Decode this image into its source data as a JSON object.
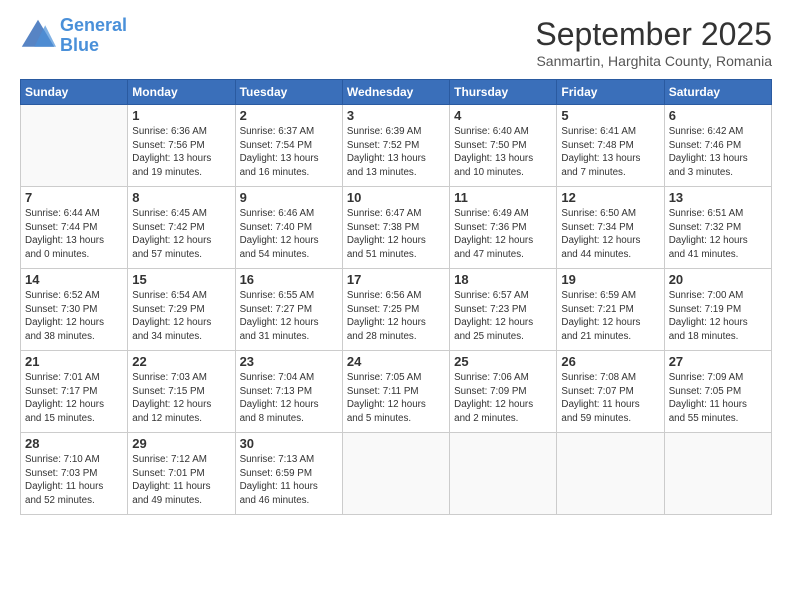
{
  "header": {
    "logo_line1": "General",
    "logo_line2": "Blue",
    "month": "September 2025",
    "location": "Sanmartin, Harghita County, Romania"
  },
  "weekdays": [
    "Sunday",
    "Monday",
    "Tuesday",
    "Wednesday",
    "Thursday",
    "Friday",
    "Saturday"
  ],
  "weeks": [
    [
      {
        "day": "",
        "info": ""
      },
      {
        "day": "1",
        "info": "Sunrise: 6:36 AM\nSunset: 7:56 PM\nDaylight: 13 hours\nand 19 minutes."
      },
      {
        "day": "2",
        "info": "Sunrise: 6:37 AM\nSunset: 7:54 PM\nDaylight: 13 hours\nand 16 minutes."
      },
      {
        "day": "3",
        "info": "Sunrise: 6:39 AM\nSunset: 7:52 PM\nDaylight: 13 hours\nand 13 minutes."
      },
      {
        "day": "4",
        "info": "Sunrise: 6:40 AM\nSunset: 7:50 PM\nDaylight: 13 hours\nand 10 minutes."
      },
      {
        "day": "5",
        "info": "Sunrise: 6:41 AM\nSunset: 7:48 PM\nDaylight: 13 hours\nand 7 minutes."
      },
      {
        "day": "6",
        "info": "Sunrise: 6:42 AM\nSunset: 7:46 PM\nDaylight: 13 hours\nand 3 minutes."
      }
    ],
    [
      {
        "day": "7",
        "info": "Sunrise: 6:44 AM\nSunset: 7:44 PM\nDaylight: 13 hours\nand 0 minutes."
      },
      {
        "day": "8",
        "info": "Sunrise: 6:45 AM\nSunset: 7:42 PM\nDaylight: 12 hours\nand 57 minutes."
      },
      {
        "day": "9",
        "info": "Sunrise: 6:46 AM\nSunset: 7:40 PM\nDaylight: 12 hours\nand 54 minutes."
      },
      {
        "day": "10",
        "info": "Sunrise: 6:47 AM\nSunset: 7:38 PM\nDaylight: 12 hours\nand 51 minutes."
      },
      {
        "day": "11",
        "info": "Sunrise: 6:49 AM\nSunset: 7:36 PM\nDaylight: 12 hours\nand 47 minutes."
      },
      {
        "day": "12",
        "info": "Sunrise: 6:50 AM\nSunset: 7:34 PM\nDaylight: 12 hours\nand 44 minutes."
      },
      {
        "day": "13",
        "info": "Sunrise: 6:51 AM\nSunset: 7:32 PM\nDaylight: 12 hours\nand 41 minutes."
      }
    ],
    [
      {
        "day": "14",
        "info": "Sunrise: 6:52 AM\nSunset: 7:30 PM\nDaylight: 12 hours\nand 38 minutes."
      },
      {
        "day": "15",
        "info": "Sunrise: 6:54 AM\nSunset: 7:29 PM\nDaylight: 12 hours\nand 34 minutes."
      },
      {
        "day": "16",
        "info": "Sunrise: 6:55 AM\nSunset: 7:27 PM\nDaylight: 12 hours\nand 31 minutes."
      },
      {
        "day": "17",
        "info": "Sunrise: 6:56 AM\nSunset: 7:25 PM\nDaylight: 12 hours\nand 28 minutes."
      },
      {
        "day": "18",
        "info": "Sunrise: 6:57 AM\nSunset: 7:23 PM\nDaylight: 12 hours\nand 25 minutes."
      },
      {
        "day": "19",
        "info": "Sunrise: 6:59 AM\nSunset: 7:21 PM\nDaylight: 12 hours\nand 21 minutes."
      },
      {
        "day": "20",
        "info": "Sunrise: 7:00 AM\nSunset: 7:19 PM\nDaylight: 12 hours\nand 18 minutes."
      }
    ],
    [
      {
        "day": "21",
        "info": "Sunrise: 7:01 AM\nSunset: 7:17 PM\nDaylight: 12 hours\nand 15 minutes."
      },
      {
        "day": "22",
        "info": "Sunrise: 7:03 AM\nSunset: 7:15 PM\nDaylight: 12 hours\nand 12 minutes."
      },
      {
        "day": "23",
        "info": "Sunrise: 7:04 AM\nSunset: 7:13 PM\nDaylight: 12 hours\nand 8 minutes."
      },
      {
        "day": "24",
        "info": "Sunrise: 7:05 AM\nSunset: 7:11 PM\nDaylight: 12 hours\nand 5 minutes."
      },
      {
        "day": "25",
        "info": "Sunrise: 7:06 AM\nSunset: 7:09 PM\nDaylight: 12 hours\nand 2 minutes."
      },
      {
        "day": "26",
        "info": "Sunrise: 7:08 AM\nSunset: 7:07 PM\nDaylight: 11 hours\nand 59 minutes."
      },
      {
        "day": "27",
        "info": "Sunrise: 7:09 AM\nSunset: 7:05 PM\nDaylight: 11 hours\nand 55 minutes."
      }
    ],
    [
      {
        "day": "28",
        "info": "Sunrise: 7:10 AM\nSunset: 7:03 PM\nDaylight: 11 hours\nand 52 minutes."
      },
      {
        "day": "29",
        "info": "Sunrise: 7:12 AM\nSunset: 7:01 PM\nDaylight: 11 hours\nand 49 minutes."
      },
      {
        "day": "30",
        "info": "Sunrise: 7:13 AM\nSunset: 6:59 PM\nDaylight: 11 hours\nand 46 minutes."
      },
      {
        "day": "",
        "info": ""
      },
      {
        "day": "",
        "info": ""
      },
      {
        "day": "",
        "info": ""
      },
      {
        "day": "",
        "info": ""
      }
    ]
  ]
}
